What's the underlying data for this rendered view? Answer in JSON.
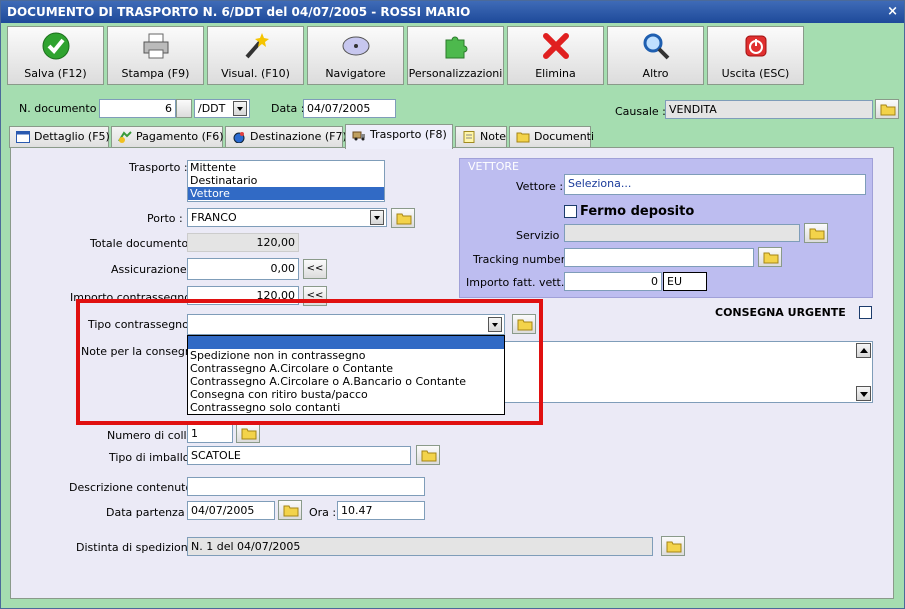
{
  "window": {
    "title": "DOCUMENTO DI TRASPORTO N. 6/DDT del 04/07/2005 - ROSSI MARIO",
    "close": "×"
  },
  "toolbar": [
    {
      "label": "Salva (F12)",
      "icon": "check-icon"
    },
    {
      "label": "Stampa (F9)",
      "icon": "printer-icon"
    },
    {
      "label": "Visual. (F10)",
      "icon": "magic-wand-icon"
    },
    {
      "label": "Navigatore",
      "icon": "compass-icon"
    },
    {
      "label": "Personalizzazioni",
      "icon": "puzzle-icon"
    },
    {
      "label": "Elimina",
      "icon": "delete-x-icon"
    },
    {
      "label": "Altro",
      "icon": "magnifier-icon"
    },
    {
      "label": "Uscita (ESC)",
      "icon": "power-icon"
    }
  ],
  "header": {
    "ndoc_label": "N. documento :",
    "ndoc_value": "6",
    "series_value": "/DDT",
    "data_label": "Data :",
    "data_value": "04/07/2005",
    "causale_label": "Causale :",
    "causale_value": "VENDITA"
  },
  "tabs": [
    {
      "label": "Dettaglio (F5)",
      "icon": "window-icon"
    },
    {
      "label": "Pagamento (F6)",
      "icon": "payment-icon"
    },
    {
      "label": "Destinazione (F7)",
      "icon": "globe-icon"
    },
    {
      "label": "Trasporto (F8)",
      "icon": "truck-icon"
    },
    {
      "label": "Note",
      "icon": "note-icon"
    },
    {
      "label": "Documenti",
      "icon": "folder-icon"
    }
  ],
  "trasporto": {
    "label": "Trasporto :",
    "options": [
      "Mittente",
      "Destinatario",
      "Vettore"
    ],
    "selected": "Vettore"
  },
  "porto": {
    "label": "Porto :",
    "value": "FRANCO"
  },
  "totale": {
    "label": "Totale documento :",
    "value": "120,00"
  },
  "assicurazione": {
    "label": "Assicurazione :",
    "value": "0,00",
    "btn": "<<"
  },
  "importo_contrassegno": {
    "label": "Importo contrassegno :",
    "value": "120,00",
    "btn": "<<"
  },
  "tipo_contrassegno": {
    "label": "Tipo contrassegno :",
    "value": "",
    "options": [
      "",
      "Spedizione non in contrassegno",
      "Contrassegno A.Circolare o Contante",
      "Contrassegno A.Circolare o A.Bancario o Contante",
      "Consegna con ritiro busta/pacco",
      "Contrassegno solo contanti"
    ]
  },
  "note_consegna": {
    "label": "Note per la consegna"
  },
  "colli": {
    "label": "Numero di colli :",
    "value": "1"
  },
  "imballo": {
    "label": "Tipo di imballo :",
    "value": "SCATOLE"
  },
  "descrizione": {
    "label": "Descrizione contenuto :",
    "value": ""
  },
  "partenza": {
    "date_label": "Data partenza :",
    "date_value": "04/07/2005",
    "ora_label": "Ora :",
    "ora_value": "10.47"
  },
  "distinta": {
    "label": "Distinta di spedizione :",
    "value": "N. 1 del 04/07/2005"
  },
  "vettore": {
    "title": "VETTORE",
    "vettore_label": "Vettore :",
    "vettore_value": "Seleziona...",
    "fermo_label": "Fermo deposito",
    "servizio_label": "Servizio :",
    "tracking_label": "Tracking number :",
    "importo_label": "Importo fatt. vett.",
    "importo_value": "0",
    "currency": "EU"
  },
  "urgente": {
    "label": "CONSEGNA URGENTE"
  },
  "colors": {
    "accent": "#316ac5",
    "highlight": "#e01010",
    "window_bg": "#a5ddb0",
    "vettore_bg": "#bdbdf0"
  }
}
